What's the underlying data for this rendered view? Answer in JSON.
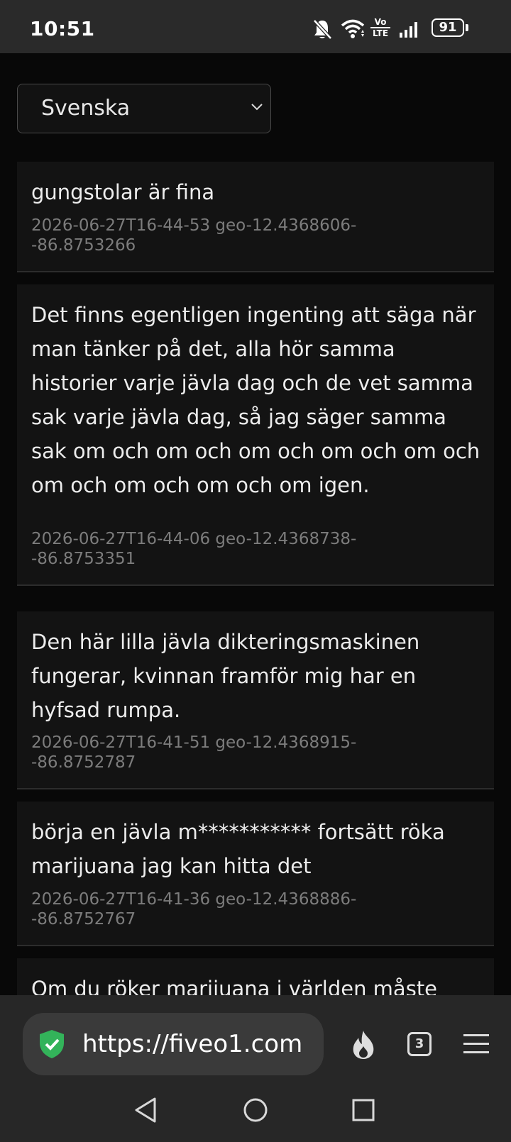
{
  "status_bar": {
    "time": "10:51",
    "battery": "91",
    "volte_top": "Vo",
    "volte_bottom": "LTE"
  },
  "language_select": {
    "selected": "Svenska"
  },
  "entries": [
    {
      "text": "gungstolar är fina",
      "meta": "2026-06-27T16-44-53 geo-12.4368606-\n-86.8753266"
    },
    {
      "text": "Det finns egentligen ingenting att säga när man tänker på det, alla hör samma historier varje jävla dag och de vet samma sak varje jävla dag, så jag säger samma sak om och om och om och om och om och om och om och om och om igen.",
      "meta": "2026-06-27T16-44-06 geo-12.4368738-\n-86.8753351"
    },
    {
      "text": "Den här lilla jävla dikteringsmaskinen fungerar, kvinnan framför mig har en hyfsad rumpa.",
      "meta": "2026-06-27T16-41-51 geo-12.4368915-\n-86.8752787"
    },
    {
      "text": "börja en jävla m*********** fortsätt röka marijuana jag kan hitta det",
      "meta": "2026-06-27T16-41-36 geo-12.4368886-\n-86.8752767"
    },
    {
      "text": "Om du röker marijuana i världen måste"
    }
  ],
  "browser": {
    "url": "https://fiveo1.com",
    "tab_count": "3"
  },
  "colors": {
    "background": "#080808",
    "entry_background": "#131313",
    "toolbar_background": "#272727",
    "shield_green": "#33b35a"
  }
}
